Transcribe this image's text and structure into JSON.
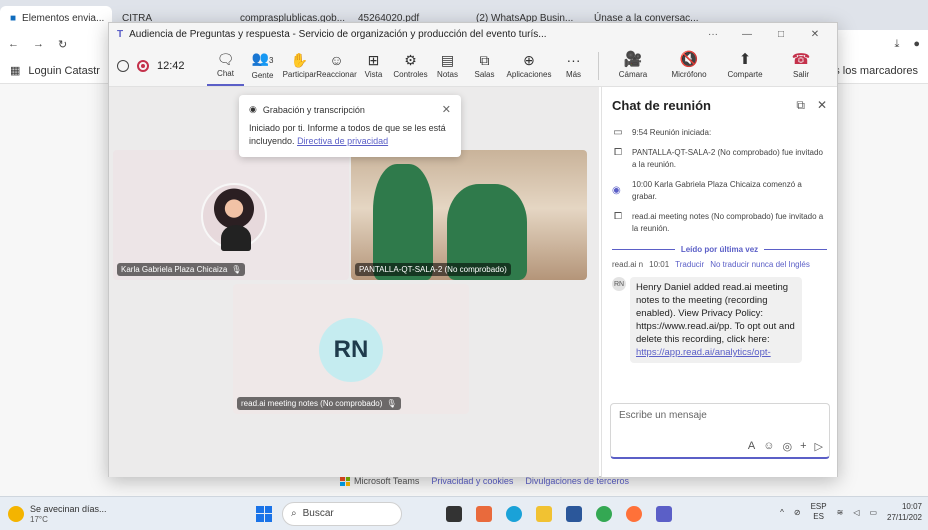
{
  "browser": {
    "tabs": [
      "Elementos envia...",
      "CITRA",
      "comprasplublicas.gob...",
      "45264020.pdf",
      "(2) WhatsApp Busin...",
      "Únase a la conversac..."
    ],
    "bookmark_loguin": "Loguin Catastr",
    "bookmarks_all": "Todos los marcadores"
  },
  "teams": {
    "window_title": "Audiencia de Preguntas y respuesta - Servicio de organización y producción del evento turís...",
    "timer": "12:42",
    "toolbar": {
      "chat": "Chat",
      "people": "Gente",
      "people_count": "3",
      "raise": "Participar",
      "react": "Reaccionar",
      "view": "Vista",
      "controls": "Controles",
      "notes": "Notas",
      "rooms": "Salas",
      "apps": "Aplicaciones",
      "more": "Más",
      "camera": "Cámara",
      "mic": "Micrófono",
      "share": "Comparte",
      "leave": "Salir"
    },
    "toast": {
      "title": "Grabación y transcripción",
      "body": "Iniciado por ti. Informe a todos de que se les está incluyendo.",
      "link": "Directiva de privacidad"
    },
    "tiles": [
      {
        "name": "Karla Gabriela Plaza Chicaiza"
      },
      {
        "name": "PANTALLA-QT-SALA-2 (No comprobado)"
      },
      {
        "name": "read.ai meeting notes (No comprobado)",
        "initials": "RN"
      }
    ]
  },
  "chat": {
    "title": "Chat de reunión",
    "events": [
      {
        "icon": "meeting-icon",
        "text": "9:54  Reunión iniciada:"
      },
      {
        "icon": "invite-icon",
        "text": "PANTALLA-QT-SALA-2 (No comprobado) fue invitado a la reunión."
      },
      {
        "icon": "record-icon",
        "text": "10:00  Karla Gabriela Plaza Chicaiza comenzó a grabar."
      },
      {
        "icon": "invite-icon",
        "text": "read.ai meeting notes (No comprobado) fue invitado a la reunión."
      }
    ],
    "last_read": "Leído por última vez",
    "sender_short": "read.ai n",
    "msg_time": "10:01",
    "translate": "Traducir",
    "never_translate": "No traducir nunca del Inglés",
    "avatar": "RN",
    "message_text": "Henry Daniel added read.ai meeting notes to the meeting (recording enabled). View Privacy Policy: https://www.read.ai/pp. To opt out and delete this recording, click here:",
    "message_link": "https://app.read.ai/analytics/opt-",
    "composer_placeholder": "Escribe un mensaje"
  },
  "page_footer": {
    "brand": "Microsoft Teams",
    "privacy": "Privacidad y cookies",
    "third": "Divulgaciones de terceros"
  },
  "taskbar": {
    "weather_title": "Se avecinan días...",
    "weather_temp": "17°C",
    "search": "Buscar",
    "lang_top": "ESP",
    "lang_bottom": "ES",
    "time": "10:07",
    "date": "27/11/202"
  }
}
